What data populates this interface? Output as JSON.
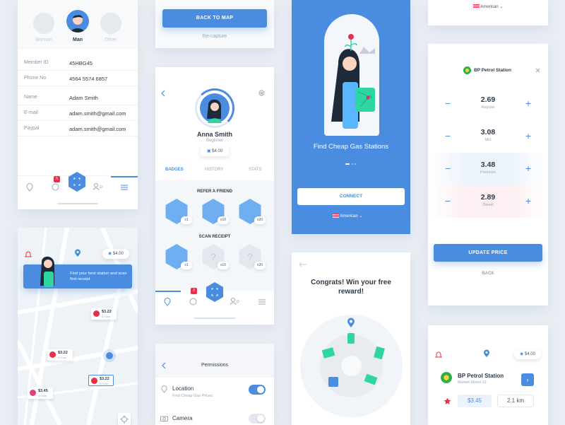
{
  "profile": {
    "genders": [
      "Woman",
      "Man",
      "Other"
    ],
    "fields": [
      {
        "label": "Member ID",
        "value": "45HBG45"
      },
      {
        "label": "Phone No",
        "value": "4564 5574 6857"
      },
      {
        "label": "Name",
        "value": "Adam Smith"
      },
      {
        "label": "E-mail",
        "value": "adam.smith@gmail.com"
      },
      {
        "label": "Paypal",
        "value": "adam.smith@gmail.com"
      }
    ],
    "badge_count": "5"
  },
  "map": {
    "balance": "$4.00",
    "banner": "Find your best station and scan first receipt",
    "markers": [
      {
        "price": "$3.22",
        "dist": "0.9 km"
      },
      {
        "price": "$3.22",
        "dist": "0.9 km"
      },
      {
        "price": "$3.45",
        "dist": "0.9 km"
      },
      {
        "price": "$3.22",
        "dist": "0.9 km"
      }
    ]
  },
  "scan": {
    "back_button": "BACK TO MAP",
    "recapture": "Re-capture"
  },
  "user": {
    "name": "Anna Smith",
    "level": "Beginner",
    "balance": "$4.00",
    "tabs": [
      "BADGES",
      "HISTORY",
      "STATS"
    ],
    "section1": "REFER A FRIEND",
    "section2": "SCAN RECEIPT",
    "counts": [
      "x1",
      "x10",
      "x20",
      "x1",
      "x10",
      "x20"
    ],
    "badge_count": "3"
  },
  "perms": {
    "title": "Permissions",
    "items": [
      {
        "label": "Location",
        "sub": "Find Cheap Gas Prices"
      },
      {
        "label": "Camera",
        "sub": ""
      }
    ]
  },
  "onboard": {
    "title": "Find Cheap Gas Stations",
    "connect": "CONNECT",
    "lang": "American"
  },
  "reward": {
    "title": "Congrats! Win your free reward!"
  },
  "station": {
    "lang": "American",
    "name": "BP Petrol Station",
    "prices": [
      {
        "value": "2.69",
        "label": "Regular"
      },
      {
        "value": "3.08",
        "label": "Mid"
      },
      {
        "value": "3.48",
        "label": "Premium"
      },
      {
        "value": "2.89",
        "label": "Diesel"
      }
    ],
    "update": "UPDATE PRICE",
    "back": "BACK"
  },
  "detail": {
    "balance": "$4.00",
    "name": "BP Petrol Station",
    "address": "Market Street 12",
    "price": "$3.45",
    "distance": "2.1 km"
  },
  "colors": {
    "accent": "#4a8de0",
    "red": "#e8304a",
    "green": "#2fd6a4"
  }
}
